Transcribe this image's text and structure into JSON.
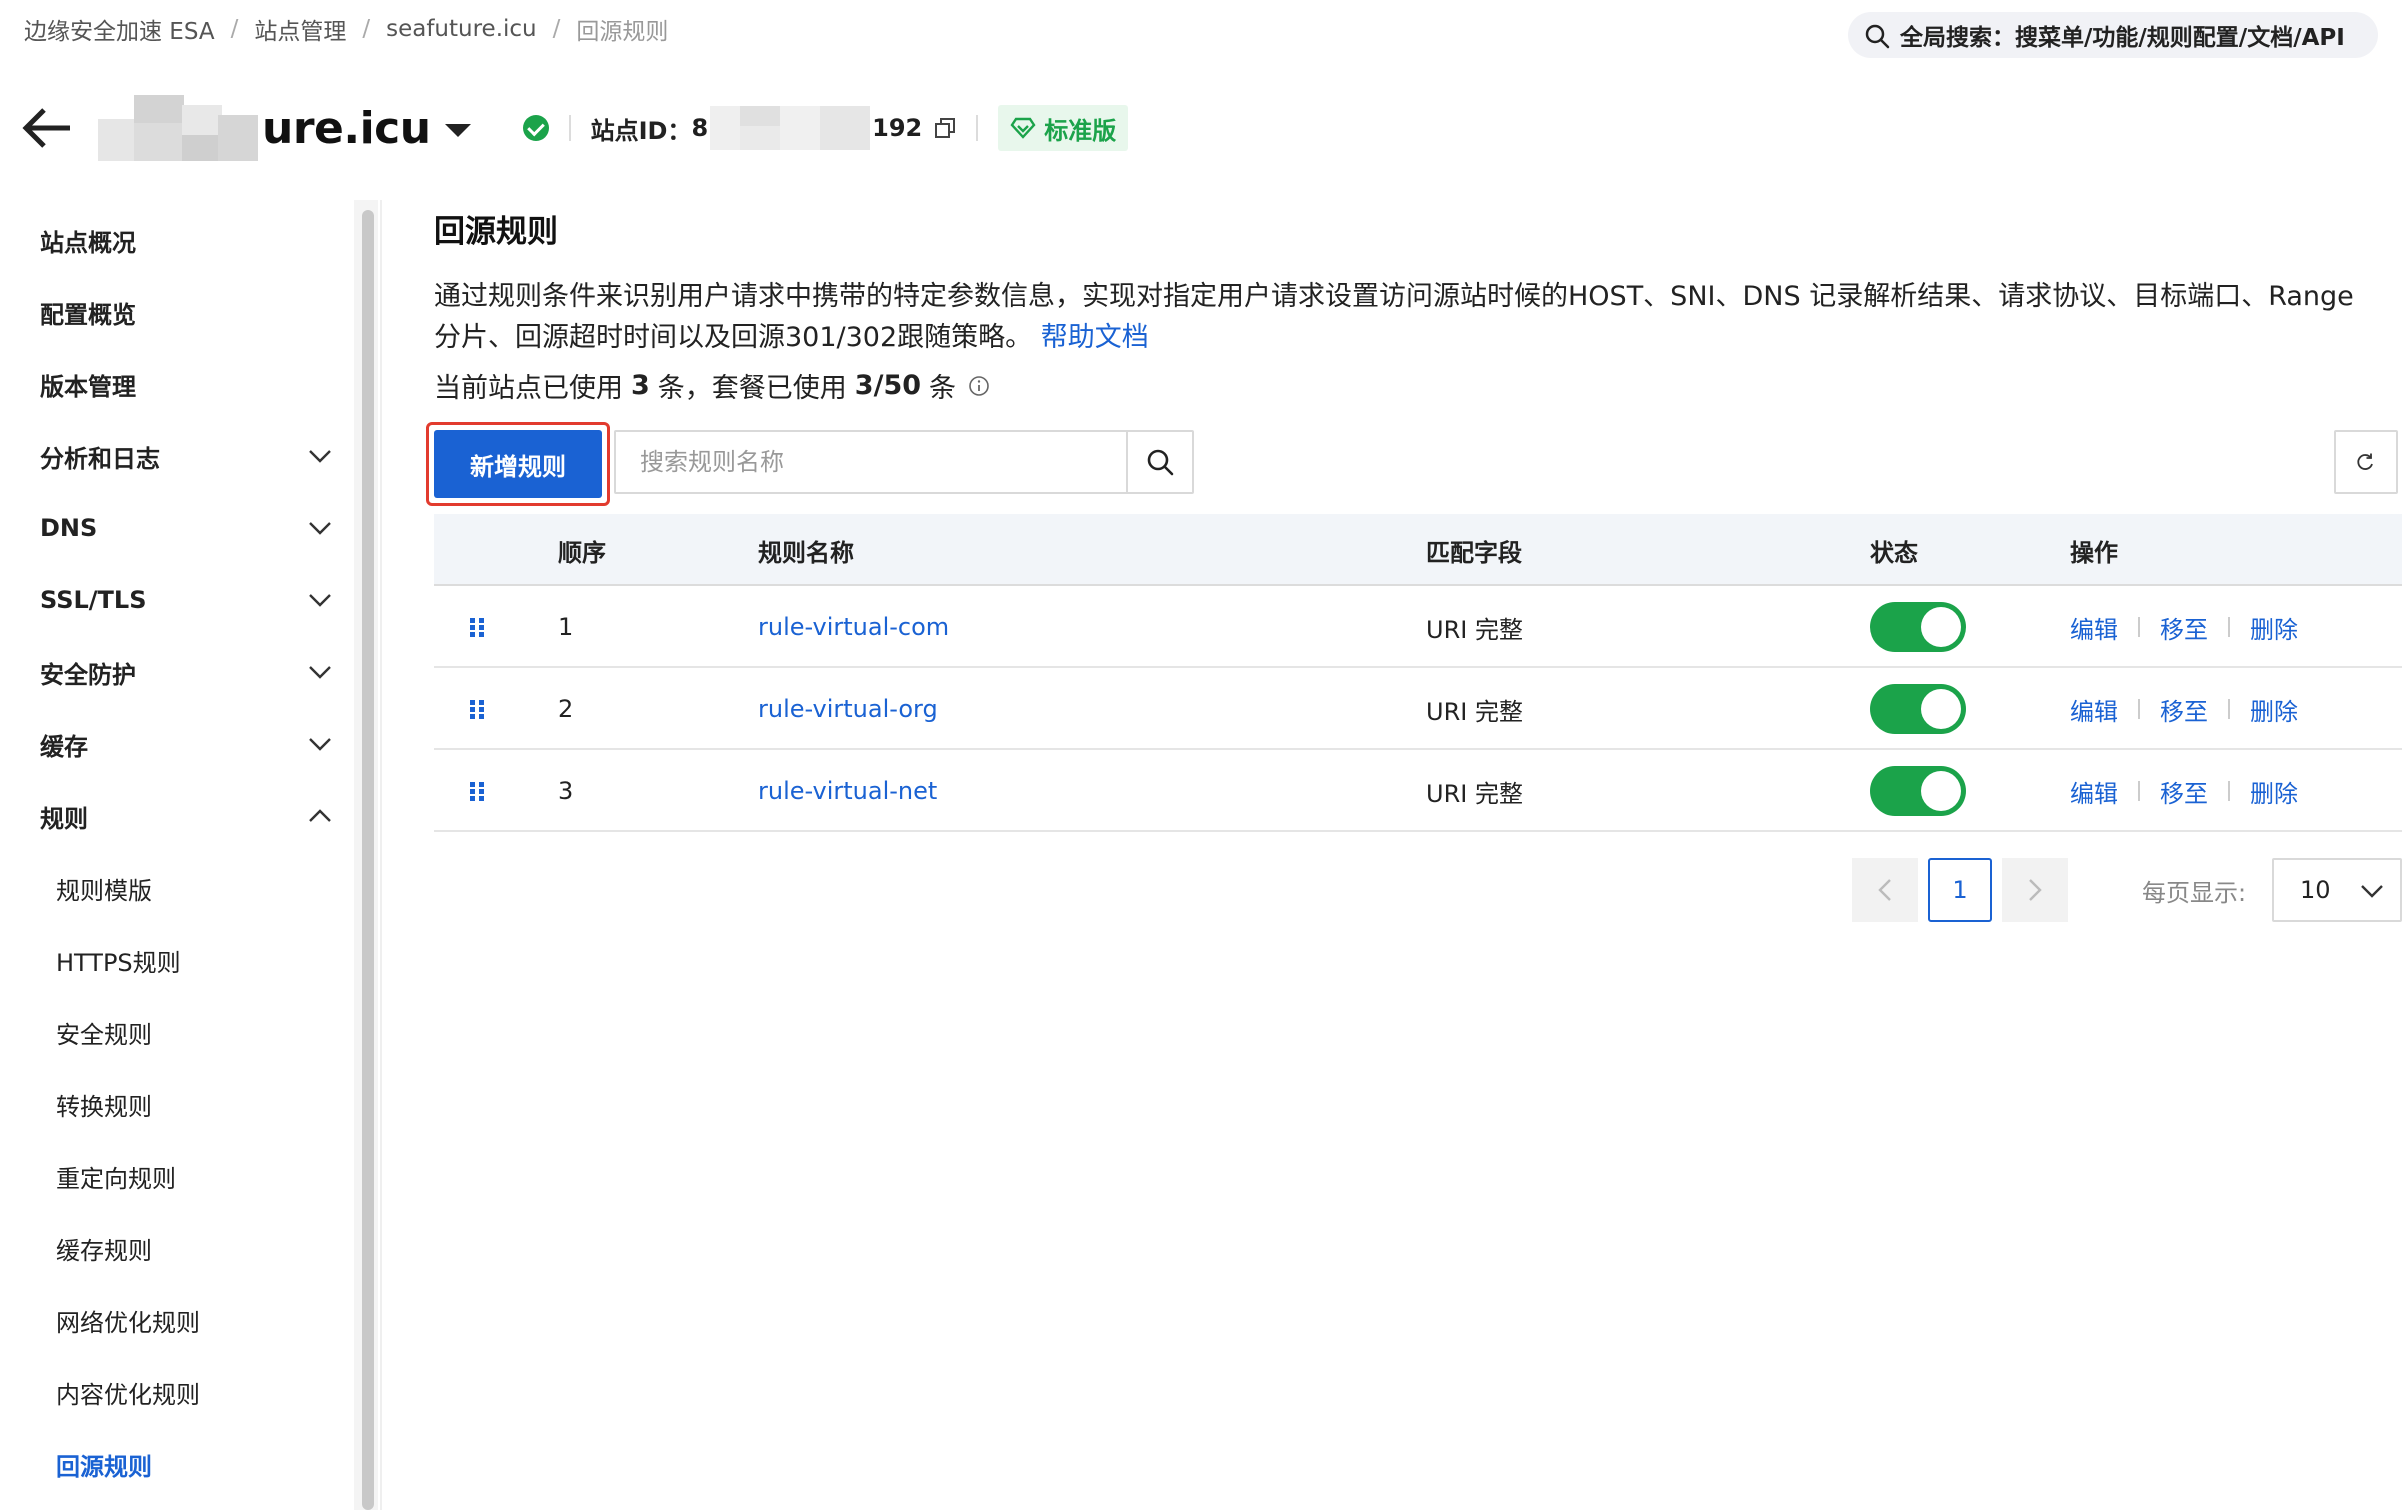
{
  "breadcrumb": {
    "items": [
      "边缘安全加速 ESA",
      "站点管理",
      "seafuture.icu",
      "回源规则"
    ]
  },
  "global_search": {
    "label": "全局搜索：搜菜单/功能/规则配置/文档/API"
  },
  "header": {
    "site_name_visible": "ure.icu",
    "site_id_label": "站点ID：",
    "site_id_prefix": "8",
    "site_id_suffix": "192",
    "edition": "标准版",
    "accent_green": "#1ba34a"
  },
  "sidebar": {
    "items": [
      {
        "label": "站点概况"
      },
      {
        "label": "配置概览"
      },
      {
        "label": "版本管理"
      },
      {
        "label": "分析和日志"
      },
      {
        "label": "DNS"
      },
      {
        "label": "SSL/TLS"
      },
      {
        "label": "安全防护"
      },
      {
        "label": "缓存"
      },
      {
        "label": "规则"
      }
    ],
    "sub_items": [
      {
        "label": "规则模版"
      },
      {
        "label": "HTTPS规则"
      },
      {
        "label": "安全规则"
      },
      {
        "label": "转换规则"
      },
      {
        "label": "重定向规则"
      },
      {
        "label": "缓存规则"
      },
      {
        "label": "网络优化规则"
      },
      {
        "label": "内容优化规则"
      },
      {
        "label": "回源规则"
      }
    ]
  },
  "main": {
    "title": "回源规则",
    "description": "通过规则条件来识别用户请求中携带的特定参数信息，实现对指定用户请求设置访问源站时候的HOST、SNI、DNS 记录解析结果、请求协议、目标端口、Range分片、回源超时时间以及回源301/302跟随策略。",
    "help_link": "帮助文档",
    "usage_prefix": "当前站点已使用",
    "usage_count": "3",
    "usage_mid": "条，套餐已使用",
    "usage_quota": "3/50",
    "usage_suffix": "条",
    "add_button": "新增规则",
    "search_placeholder": "搜索规则名称",
    "brand_blue": "#1a62d3",
    "highlight_red": "#e23b2e"
  },
  "table": {
    "headers": [
      "顺序",
      "规则名称",
      "匹配字段",
      "状态",
      "操作"
    ],
    "rows": [
      {
        "order": "1",
        "name": "rule-virtual-com",
        "match": "URI 完整",
        "enabled": true,
        "edit": "编辑",
        "move": "移至",
        "delete": "删除"
      },
      {
        "order": "2",
        "name": "rule-virtual-org",
        "match": "URI 完整",
        "enabled": true,
        "edit": "编辑",
        "move": "移至",
        "delete": "删除"
      },
      {
        "order": "3",
        "name": "rule-virtual-net",
        "match": "URI 完整",
        "enabled": true,
        "edit": "编辑",
        "move": "移至",
        "delete": "删除"
      }
    ]
  },
  "pagination": {
    "current_page": "1",
    "page_size_label": "每页显示:",
    "page_size": "10"
  }
}
